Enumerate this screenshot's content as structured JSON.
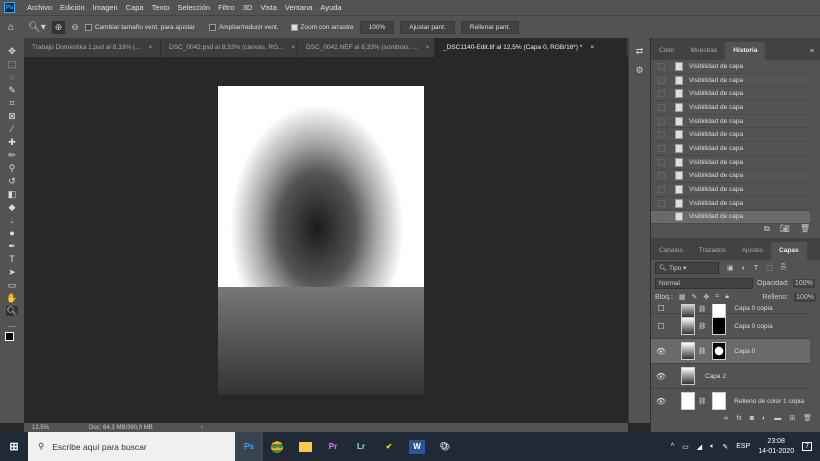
{
  "app": {
    "logo": "Ps"
  },
  "menu": [
    "Archivo",
    "Edición",
    "Imagen",
    "Capa",
    "Texto",
    "Selección",
    "Filtro",
    "3D",
    "Vista",
    "Ventana",
    "Ayuda"
  ],
  "options": {
    "resize_windows": "Cambiar tamaño vent. para ajustar",
    "resize_windows_checked": false,
    "zoom_all": "Ampliar/reducir vent.",
    "zoom_all_checked": false,
    "scrubby": "Zoom con arrastre",
    "scrubby_checked": true,
    "zoom_100": "100%",
    "fit": "Ajustar pant.",
    "fill": "Rellenar pant."
  },
  "tabs": [
    {
      "label": "Trabajo Domestika 1.psd al 8,33% (..."
    },
    {
      "label": "DSC_0042.psd al 8,33% (canvas, RG..."
    },
    {
      "label": "DSC_0042.NEF al 8,33% (sombras, ..."
    },
    {
      "label": "_DSC1140-Edit.tif al 12,5% (Capa 0, RGB/16*) *",
      "active": true
    }
  ],
  "history_panel": {
    "tabs": [
      "Color",
      "Muestras",
      "Historia"
    ],
    "active": "Historia",
    "items": [
      "Visibilidad de capa",
      "Visibilidad de capa",
      "Visibilidad de capa",
      "Visibilidad de capa",
      "Visibilidad de capa",
      "Visibilidad de capa",
      "Visibilidad de capa",
      "Visibilidad de capa",
      "Visibilidad de capa",
      "Visibilidad de capa",
      "Visibilidad de capa",
      "Visibilidad de capa"
    ]
  },
  "layers_panel": {
    "tabs": [
      "Canales",
      "Trazados",
      "Ajustes",
      "Capas"
    ],
    "active": "Capas",
    "filter": "Tipo",
    "blend": "Normal",
    "opacity_label": "Opacidad:",
    "opacity": "100%",
    "lock_label": "Bloq.:",
    "fill_label": "Relleno:",
    "fill": "100%",
    "layers": [
      {
        "name": "Capa 0 copia",
        "visible": false
      },
      {
        "name": "Capa 0 copia",
        "visible": false
      },
      {
        "name": "Capa 0",
        "visible": true,
        "selected": true
      },
      {
        "name": "Capa 2",
        "visible": true
      },
      {
        "name": "Relleno de color 1 copia",
        "visible": true
      }
    ]
  },
  "status": {
    "zoom": "12,5%",
    "doc": "Doc: 64,3 MB/390,0 MB"
  },
  "taskbar": {
    "search_placeholder": "Escribe aquí para buscar",
    "apps": [
      "Ps",
      "Chrome",
      "Explorer",
      "Pr",
      "Lr",
      "Norton",
      "W",
      "Paint"
    ],
    "lang": "ESP",
    "time": "23:08",
    "date": "14-01-2020",
    "notifications": "7"
  }
}
